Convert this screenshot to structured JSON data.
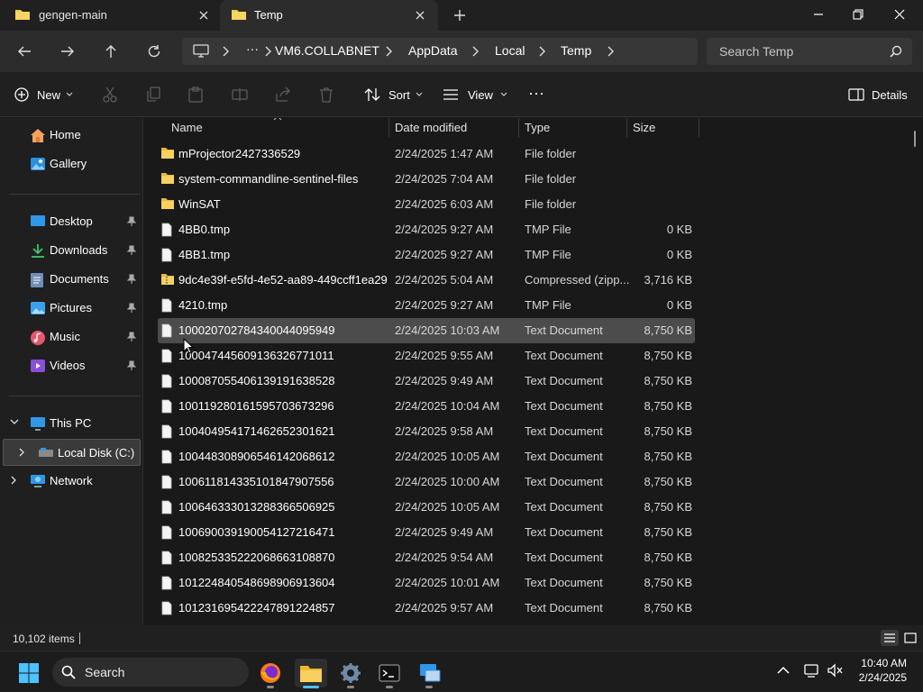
{
  "tabs": [
    {
      "label": "gengen-main"
    },
    {
      "label": "Temp"
    }
  ],
  "breadcrumb": {
    "more": "···",
    "items": [
      "VM6.COLLABNET",
      "AppData",
      "Local",
      "Temp"
    ]
  },
  "search": {
    "placeholder": "Search Temp"
  },
  "commands": {
    "new": "New",
    "sort": "Sort",
    "view": "View",
    "more": "···",
    "details": "Details"
  },
  "sidebar": {
    "quick": [
      {
        "label": "Home",
        "icon": "home-icon"
      },
      {
        "label": "Gallery",
        "icon": "gallery-icon"
      }
    ],
    "pinned": [
      {
        "label": "Desktop",
        "icon": "desktop-icon"
      },
      {
        "label": "Downloads",
        "icon": "downloads-icon"
      },
      {
        "label": "Documents",
        "icon": "documents-icon"
      },
      {
        "label": "Pictures",
        "icon": "pictures-icon"
      },
      {
        "label": "Music",
        "icon": "music-icon"
      },
      {
        "label": "Videos",
        "icon": "videos-icon"
      }
    ],
    "tree": [
      {
        "label": "This PC",
        "icon": "pc-icon"
      },
      {
        "label": "Local Disk (C:)",
        "icon": "drive-icon"
      },
      {
        "label": "Network",
        "icon": "network-icon"
      }
    ]
  },
  "columns": {
    "name": "Name",
    "date": "Date modified",
    "type": "Type",
    "size": "Size"
  },
  "files": [
    {
      "name": "mProjector2427336529",
      "date": "2/24/2025 1:47 AM",
      "type": "File folder",
      "size": "",
      "kind": "folder"
    },
    {
      "name": "system-commandline-sentinel-files",
      "date": "2/24/2025 7:04 AM",
      "type": "File folder",
      "size": "",
      "kind": "folder"
    },
    {
      "name": "WinSAT",
      "date": "2/24/2025 6:03 AM",
      "type": "File folder",
      "size": "",
      "kind": "folder"
    },
    {
      "name": "4BB0.tmp",
      "date": "2/24/2025 9:27 AM",
      "type": "TMP File",
      "size": "0 KB",
      "kind": "file"
    },
    {
      "name": "4BB1.tmp",
      "date": "2/24/2025 9:27 AM",
      "type": "TMP File",
      "size": "0 KB",
      "kind": "file"
    },
    {
      "name": "9dc4e39f-e5fd-4e52-aa89-449ccff1ea29",
      "date": "2/24/2025 5:04 AM",
      "type": "Compressed (zipp...",
      "size": "3,716 KB",
      "kind": "zip"
    },
    {
      "name": "4210.tmp",
      "date": "2/24/2025 9:27 AM",
      "type": "TMP File",
      "size": "0 KB",
      "kind": "file"
    },
    {
      "name": "1000207027843400440959​49",
      "date": "2/24/2025 10:03 AM",
      "type": "Text Document",
      "size": "8,750 KB",
      "kind": "file"
    },
    {
      "name": "1000474456091363267710​11",
      "date": "2/24/2025 9:55 AM",
      "type": "Text Document",
      "size": "8,750 KB",
      "kind": "file"
    },
    {
      "name": "1000870554061391916385​28",
      "date": "2/24/2025 9:49 AM",
      "type": "Text Document",
      "size": "8,750 KB",
      "kind": "file"
    },
    {
      "name": "1001192801615957036732​96",
      "date": "2/24/2025 10:04 AM",
      "type": "Text Document",
      "size": "8,750 KB",
      "kind": "file"
    },
    {
      "name": "1004049541714626523016​21",
      "date": "2/24/2025 9:58 AM",
      "type": "Text Document",
      "size": "8,750 KB",
      "kind": "file"
    },
    {
      "name": "1004483089065461420686​12",
      "date": "2/24/2025 10:05 AM",
      "type": "Text Document",
      "size": "8,750 KB",
      "kind": "file"
    },
    {
      "name": "1006118143351018479075​56",
      "date": "2/24/2025 10:00 AM",
      "type": "Text Document",
      "size": "8,750 KB",
      "kind": "file"
    },
    {
      "name": "1006463330132883665069​25",
      "date": "2/24/2025 10:05 AM",
      "type": "Text Document",
      "size": "8,750 KB",
      "kind": "file"
    },
    {
      "name": "1006900391900541272164​71",
      "date": "2/24/2025 9:49 AM",
      "type": "Text Document",
      "size": "8,750 KB",
      "kind": "file"
    },
    {
      "name": "1008253352220686631088​70",
      "date": "2/24/2025 9:54 AM",
      "type": "Text Document",
      "size": "8,750 KB",
      "kind": "file"
    },
    {
      "name": "1012248405486989069136​04",
      "date": "2/24/2025 10:01 AM",
      "type": "Text Document",
      "size": "8,750 KB",
      "kind": "file"
    },
    {
      "name": "1012316954222478912248​57",
      "date": "2/24/2025 9:57 AM",
      "type": "Text Document",
      "size": "8,750 KB",
      "kind": "file"
    }
  ],
  "highlighted_row": 7,
  "status": {
    "count": "10,102 items"
  },
  "taskbar": {
    "search_label": "Search"
  },
  "clock": {
    "time": "10:40 AM",
    "date": "2/24/2025"
  },
  "colors": {
    "accent": "#4cc2ff",
    "folder": "#f2c94c",
    "highlight": "#4c4c4c"
  }
}
